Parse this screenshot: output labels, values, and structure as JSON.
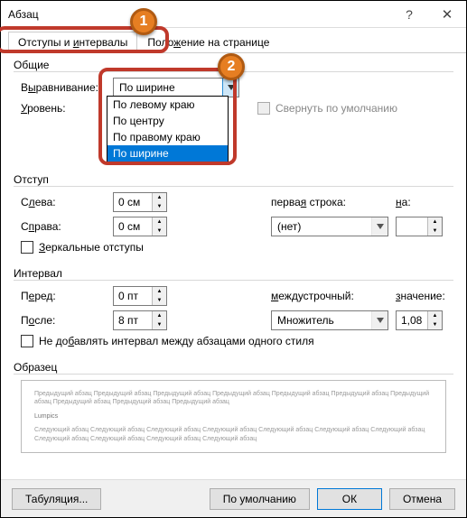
{
  "title": "Абзац",
  "titlebar": {
    "help": "?",
    "close": "✕"
  },
  "tabs": {
    "indents": {
      "pre": "Отступы и ",
      "acc": "и",
      "post": "нтервалы"
    },
    "position": {
      "pre": "Поло",
      "acc": "ж",
      "post": "ение на странице"
    }
  },
  "groups": {
    "general": "Общие",
    "indent": "Отступ",
    "spacing": "Интервал",
    "sample": "Образец"
  },
  "general": {
    "align_label": {
      "pre": "В",
      "acc": "ы",
      "post": "равнивание:"
    },
    "align_value": "По ширине",
    "level_label": {
      "pre": "",
      "acc": "У",
      "post": "ровень:"
    },
    "collapse_label": "Свернуть по умолчанию",
    "dropdown_options": {
      "left": "По левому краю",
      "center": "По центру",
      "right": "По правому краю",
      "justify": "По ширине"
    }
  },
  "indent_sec": {
    "left_label": {
      "pre": "С",
      "acc": "л",
      "post": "ева:"
    },
    "left_value": "0 см",
    "right_label": {
      "pre": "С",
      "acc": "п",
      "post": "рава:"
    },
    "right_value": "0 см",
    "first_label": {
      "pre": "перва",
      "acc": "я",
      "post": " строка:"
    },
    "first_value": "(нет)",
    "by_label": {
      "pre": "",
      "acc": "н",
      "post": "а:"
    },
    "mirror_label": {
      "pre": "",
      "acc": "З",
      "post": "еркальные отступы"
    }
  },
  "spacing_sec": {
    "before_label": {
      "pre": "П",
      "acc": "е",
      "post": "ред:"
    },
    "before_value": "0 пт",
    "after_label": {
      "pre": "П",
      "acc": "о",
      "post": "сле:"
    },
    "after_value": "8 пт",
    "line_label": {
      "pre": "",
      "acc": "м",
      "post": "еждустрочный:"
    },
    "line_value": "Множитель",
    "at_label": {
      "pre": "",
      "acc": "з",
      "post": "начение:"
    },
    "at_value": "1,08",
    "noadd_label": {
      "pre": "Не до",
      "acc": "б",
      "post": "авлять интервал между абзацами одного стиля"
    }
  },
  "preview": {
    "prev": "Предыдущий абзац Предыдущий абзац Предыдущий абзац Предыдущий абзац Предыдущий абзац Предыдущий абзац Предыдущий абзац Предыдущий абзац Предыдущий абзац Предыдущий абзац",
    "body": "Lumpics",
    "next": "Следующий абзац Следующий абзац Следующий абзац Следующий абзац Следующий абзац Следующий абзац Следующий абзац Следующий абзац Следующий абзац Следующий абзац Следующий абзац"
  },
  "footer": {
    "tabs": "Табуляция...",
    "default": "По умолчанию",
    "ok": "ОК",
    "cancel": "Отмена"
  },
  "badges": {
    "one": "1",
    "two": "2"
  }
}
